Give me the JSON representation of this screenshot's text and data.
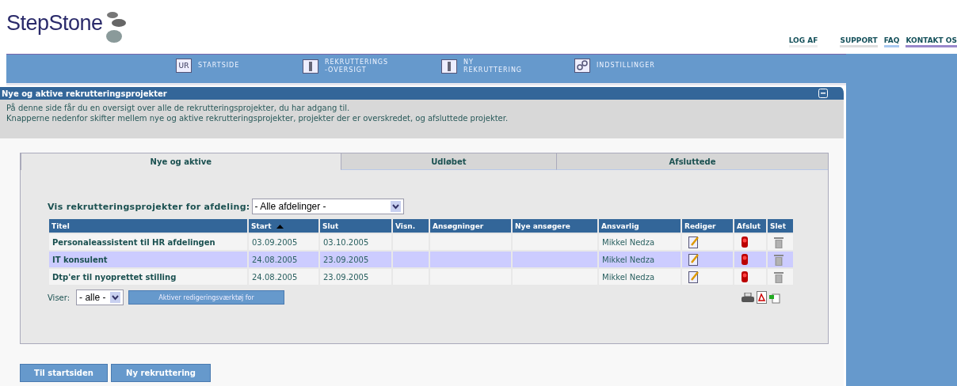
{
  "logo": {
    "text": "StepStone"
  },
  "top_links": [
    {
      "label": "LOG AF"
    },
    {
      "label": "SUPPORT"
    },
    {
      "label": "FAQ"
    },
    {
      "label": "KONTAKT OS"
    }
  ],
  "nav": [
    {
      "label": "STARTSIDE",
      "icon_text": "UR"
    },
    {
      "label": "REKRUTTERINGS\n-OVERSIGT"
    },
    {
      "label": "NY\nREKRUTTERING"
    },
    {
      "label": "INDSTILLINGER"
    }
  ],
  "panel": {
    "title": "Nye og aktive rekrutteringsprojekter",
    "description": [
      "På denne side får du en oversigt over alle de rekrutteringsprojekter, du har adgang til.",
      "Knapperne nedenfor skifter mellem nye og aktive rekrutteringsprojekter, projekter der er overskredet, og afsluttede projekter."
    ]
  },
  "tabs": [
    {
      "label": "Nye og aktive",
      "selected": true
    },
    {
      "label": "Udløbet",
      "selected": false
    },
    {
      "label": "Afsluttede",
      "selected": false
    }
  ],
  "filter": {
    "label": "Vis rekrutteringsprojekter for afdeling:",
    "value": "- Alle afdelinger -"
  },
  "table": {
    "columns": [
      {
        "label": "Titel",
        "sorted": false
      },
      {
        "label": "Start",
        "sorted": true
      },
      {
        "label": "Slut",
        "sorted": false
      },
      {
        "label": "Visn.",
        "sorted": false
      },
      {
        "label": "Ansøgninger",
        "sorted": false
      },
      {
        "label": "Nye ansøgere",
        "sorted": false
      },
      {
        "label": "Ansvarlig",
        "sorted": false
      },
      {
        "label": "Rediger",
        "sorted": false
      },
      {
        "label": "Afslut",
        "sorted": false
      },
      {
        "label": "Slet",
        "sorted": false
      }
    ],
    "rows": [
      {
        "title": "Personaleassistent til HR afdelingen",
        "start": "03.09.2005",
        "end": "03.10.2005",
        "responsible": "Mikkel Nedza",
        "selected": false
      },
      {
        "title": "IT konsulent",
        "start": "24.08.2005",
        "end": "23.09.2005",
        "responsible": "Mikkel Nedza",
        "selected": true
      },
      {
        "title": "Dtp'er til nyoprettet stilling",
        "start": "24.08.2005",
        "end": "23.09.2005",
        "responsible": "Mikkel Nedza",
        "selected": false
      }
    ]
  },
  "show": {
    "label": "Viser:",
    "value": "- alle -",
    "button": "Aktiver redigeringsværktøj for"
  },
  "buttons": [
    {
      "label": "Til startsiden"
    },
    {
      "label": "Ny rekruttering"
    }
  ]
}
